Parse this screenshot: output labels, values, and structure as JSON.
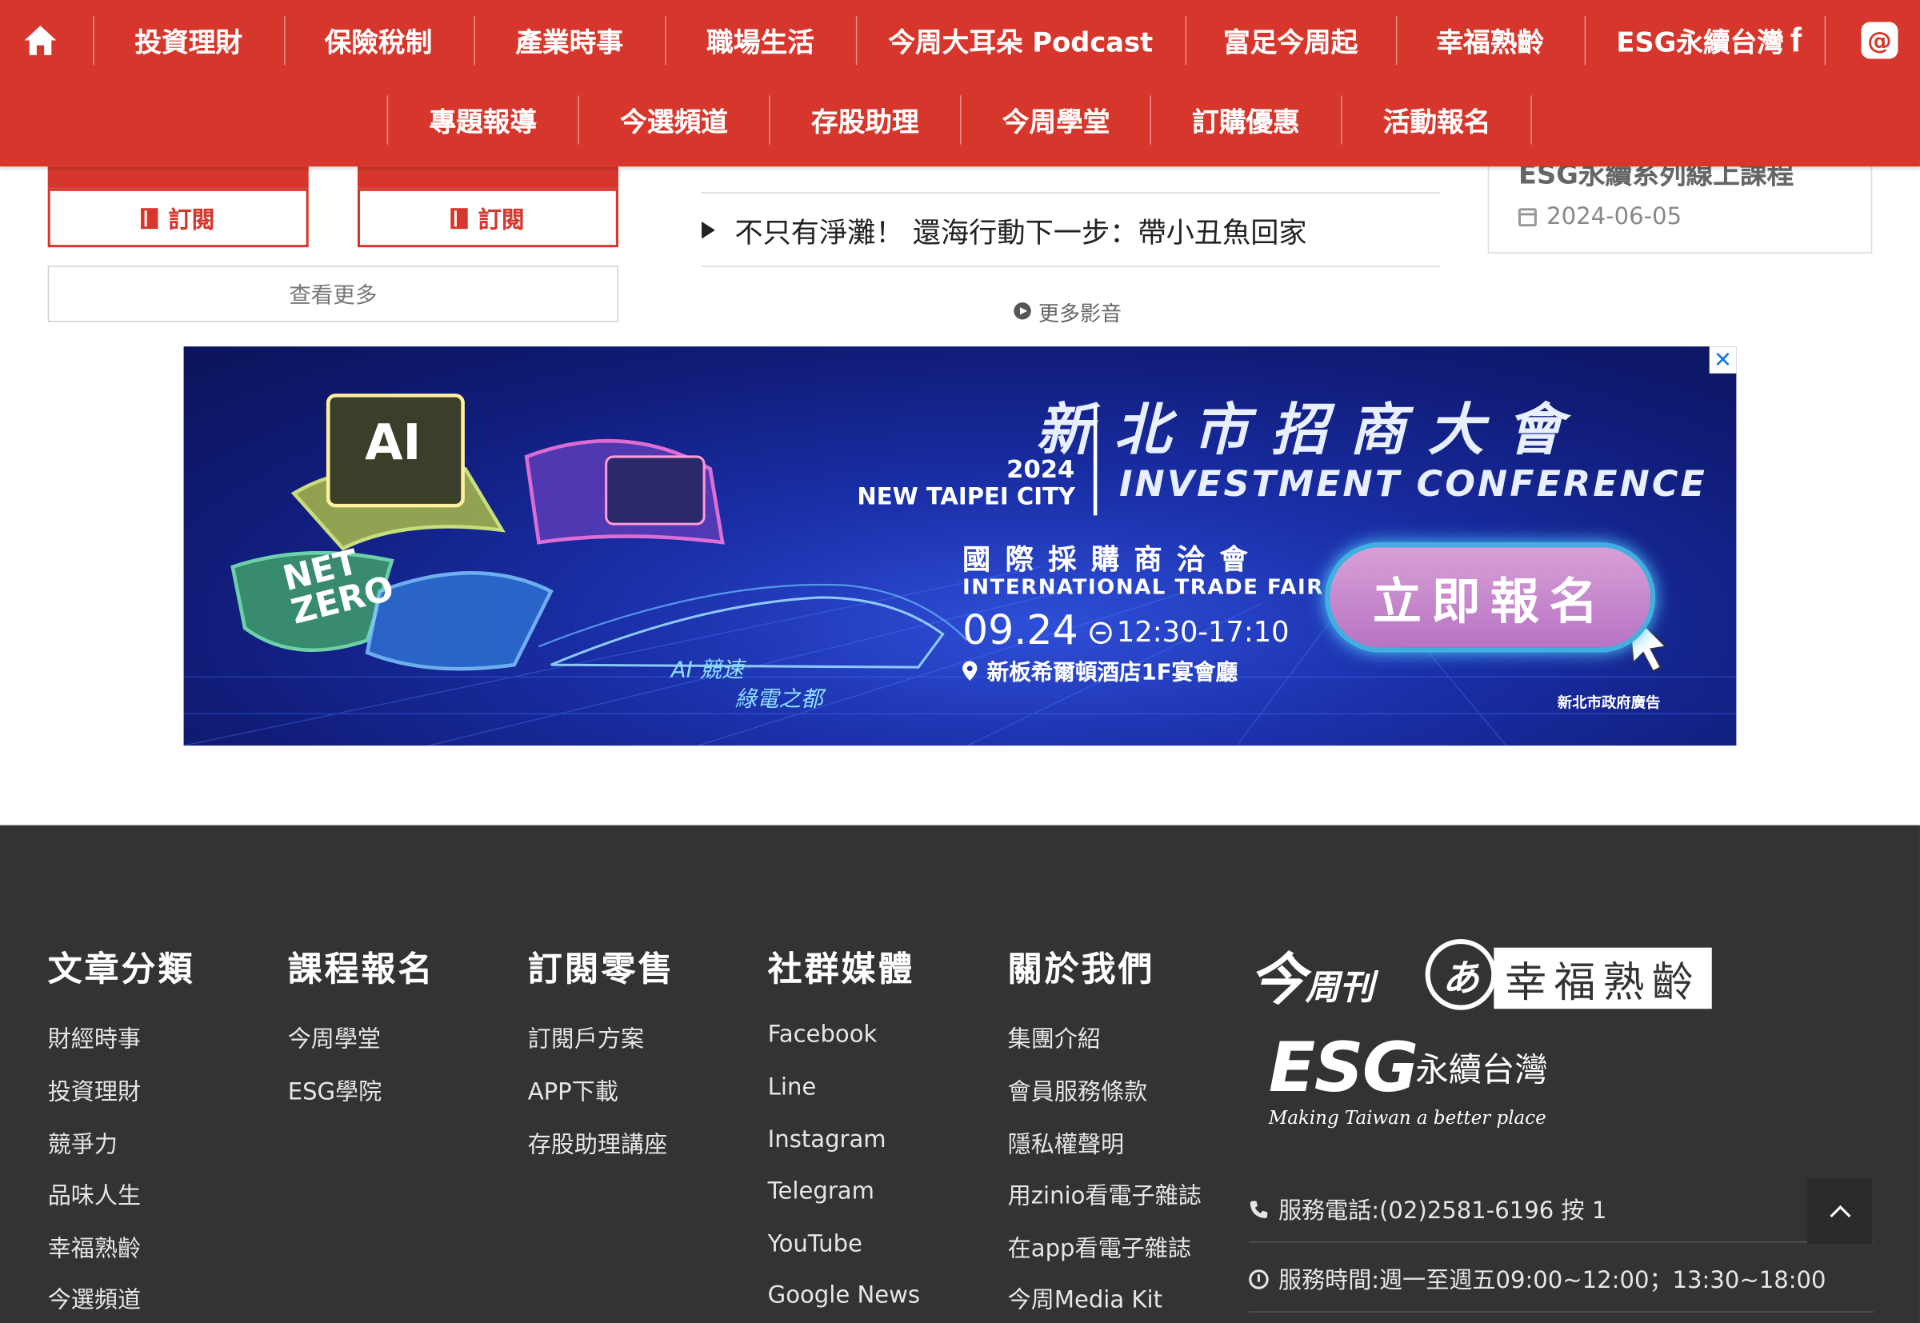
{
  "nav": {
    "row1": [
      "投資理財",
      "保險稅制",
      "產業時事",
      "職場生活",
      "今周大耳朵 Podcast",
      "富足今周起",
      "幸福熟齡",
      "ESG永續台灣"
    ],
    "row2": [
      "專題報導",
      "今選頻道",
      "存股助理",
      "今周學堂",
      "訂購優惠",
      "活動報名"
    ],
    "threads_glyph": "@"
  },
  "top": {
    "subscribe_label": "訂閱",
    "see_more": "查看更多",
    "video_title": "不只有淨灘！ 還海行動下一步：帶小丑魚回家",
    "more_videos": "更多影音",
    "right_card_title": "ESG永續系列線上課程",
    "right_card_date": "2024-06-05"
  },
  "ad": {
    "close": "✕",
    "title_zh": "新北市招商大會",
    "year": "2024",
    "city": "NEW TAIPEI CITY",
    "conference": "INVESTMENT CONFERENCE",
    "fair_zh": "國際採購商洽會",
    "fair_en": "INTERNATIONAL TRADE FAIR",
    "date": "09.24",
    "time": "12:30-17:10",
    "venue": "新板希爾頓酒店1F宴會廳",
    "cta": "立即報名",
    "gov": "新北市政府廣告",
    "slogan1": "AI 競速",
    "slogan2": "綠電之都",
    "ai_text": "AI",
    "netzero_1": "NET",
    "netzero_2": "ZERO"
  },
  "footer": {
    "columns": [
      {
        "title": "文章分類",
        "links": [
          "財經時事",
          "投資理財",
          "競爭力",
          "品味人生",
          "幸福熟齡",
          "今選頻道"
        ]
      },
      {
        "title": "課程報名",
        "links": [
          "今周學堂",
          "ESG學院"
        ]
      },
      {
        "title": "訂閱零售",
        "links": [
          "訂閱戶方案",
          "APP下載",
          "存股助理講座"
        ]
      },
      {
        "title": "社群媒體",
        "links": [
          "Facebook",
          "Line",
          "Instagram",
          "Telegram",
          "YouTube",
          "Google News"
        ]
      },
      {
        "title": "關於我們",
        "links": [
          "集團介紹",
          "會員服務條款",
          "隱私權聲明",
          "用zinio看電子雜誌",
          "在app看電子雜誌",
          "今周Media Kit"
        ]
      }
    ],
    "logo_jin_big": "今",
    "logo_jin_small": "周刊",
    "logo_fu_mark": "あ",
    "logo_fu_text": "幸福熟齡",
    "logo_esg": "ESG",
    "logo_esg_zh": "永續台灣",
    "logo_esg_tag": "Making Taiwan a better place",
    "phone": "服務電話:(02)2581-6196 按 1",
    "hours": "服務時間:週一至週五09:00~12:00；13:30~18:00"
  }
}
